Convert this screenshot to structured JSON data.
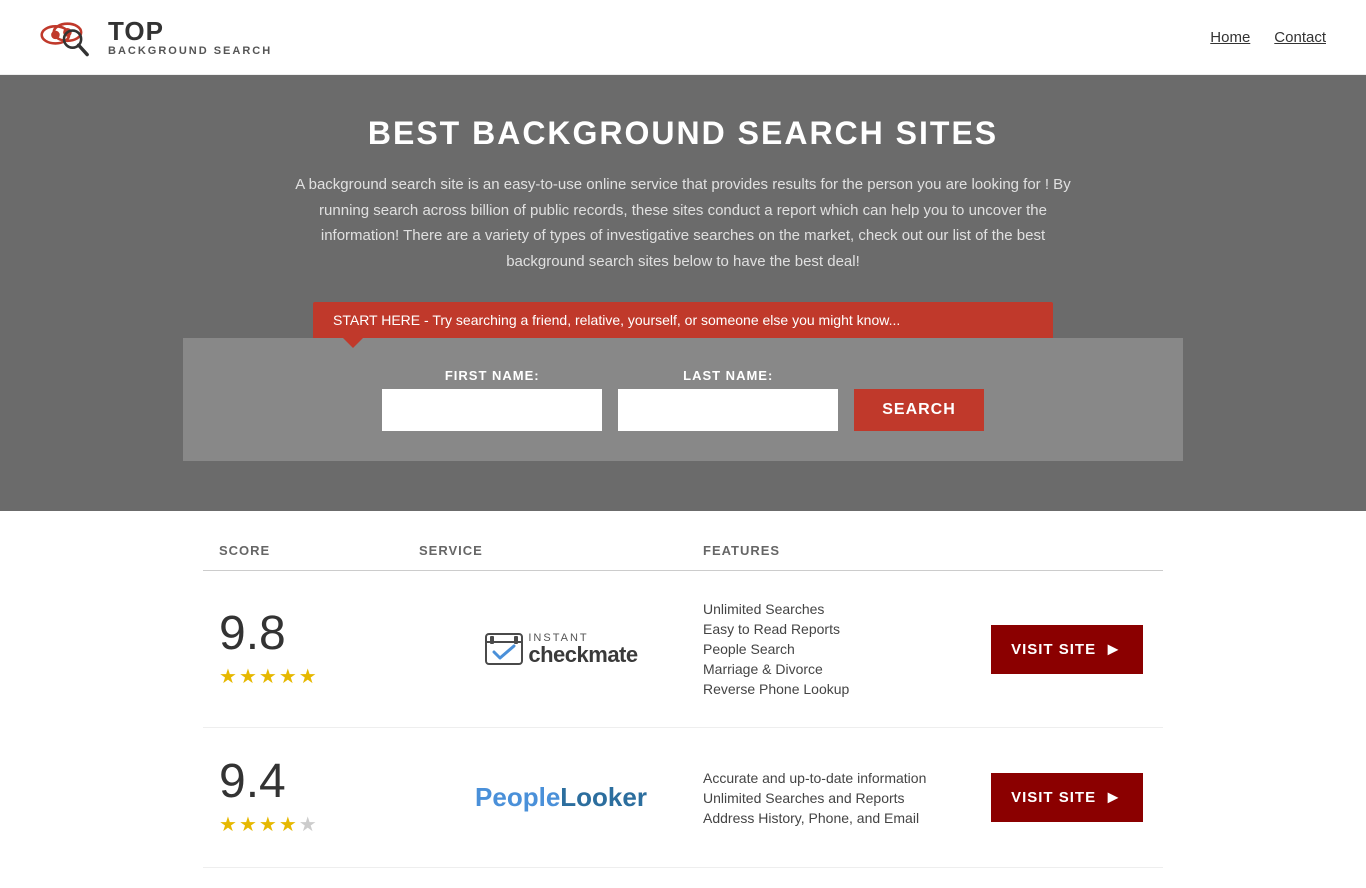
{
  "header": {
    "logo_top": "TOP",
    "logo_bottom": "BACKGROUND SEARCH",
    "nav": {
      "home": "Home",
      "contact": "Contact"
    }
  },
  "hero": {
    "title": "BEST BACKGROUND SEARCH SITES",
    "description": "A background search site is an easy-to-use online service that provides results  for the person you are looking for ! By  running  search across billion of public records, these sites conduct  a report which can help you to uncover the information! There are a variety of types of investigative searches on the market, check out our  list of the best background search sites below to have the best deal!",
    "callout": "START HERE - Try searching a friend, relative, yourself, or someone else you might know...",
    "first_name_label": "FIRST NAME:",
    "last_name_label": "LAST NAME:",
    "search_button": "SEARCH"
  },
  "table": {
    "headers": {
      "score": "SCORE",
      "service": "SERVICE",
      "features": "FEATURES"
    },
    "rows": [
      {
        "score": "9.8",
        "stars": 4.5,
        "service_name": "Instant Checkmate",
        "features": [
          "Unlimited Searches",
          "Easy to Read Reports",
          "People Search",
          "Marriage & Divorce",
          "Reverse Phone Lookup"
        ],
        "visit_label": "VISIT SITE"
      },
      {
        "score": "9.4",
        "stars": 4,
        "service_name": "PeopleLooker",
        "features": [
          "Accurate and up-to-date information",
          "Unlimited Searches and Reports",
          "Address History, Phone, and Email"
        ],
        "visit_label": "VISIT SITE"
      }
    ]
  }
}
